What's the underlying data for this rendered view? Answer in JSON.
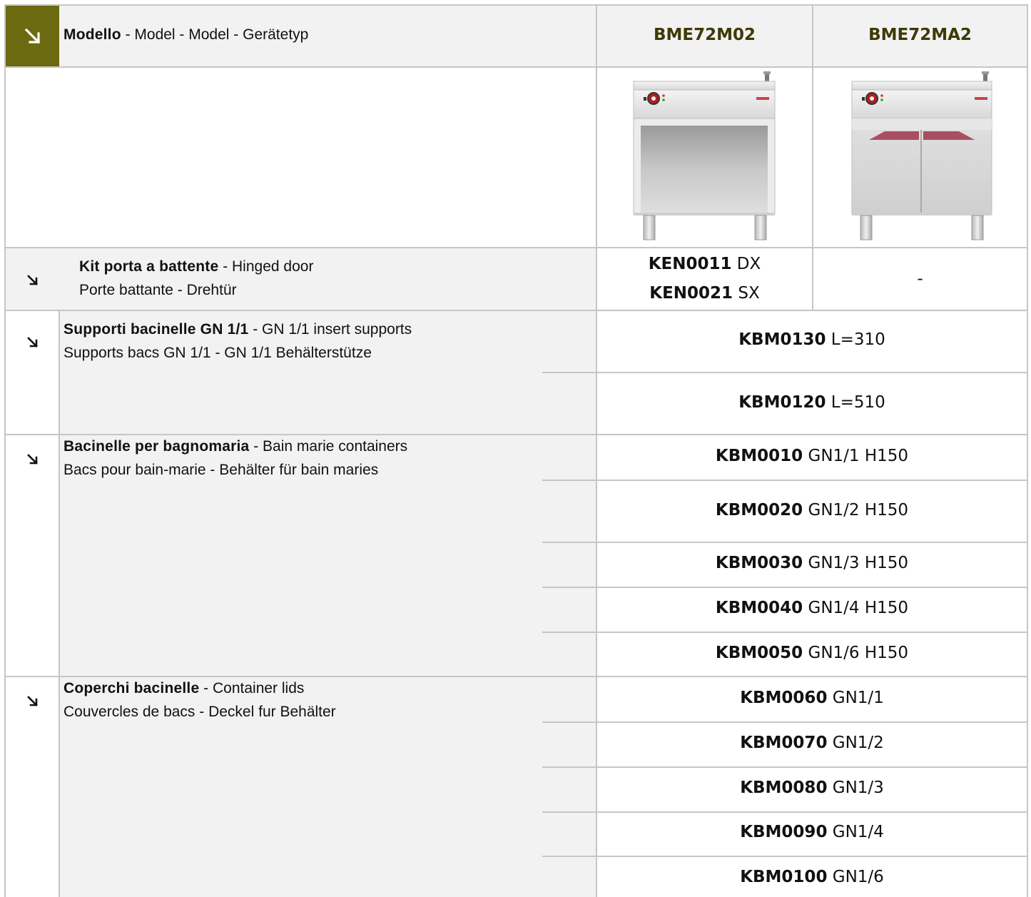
{
  "header": {
    "label_bold": "Modello",
    "label_rest": " - Model - Model - Gerätetyp",
    "models": [
      "BME72M02",
      "BME72MA2"
    ]
  },
  "icons": {
    "header_arrow": "arrow-down-right-icon",
    "row_arrow": "arrow-down-right-icon"
  },
  "colors": {
    "accent": "#6b6a10",
    "model_text": "#3d3a06",
    "grey_fill": "#f2f2f2",
    "grid": "#c6c6c6"
  },
  "accessories": [
    {
      "label_bold": "Kit porta a battente",
      "label_line1_rest": " - Hinged door",
      "label_line2": "Porte battante - Drehtür",
      "col1": [
        {
          "code": "KEN0011",
          "suffix": " DX"
        },
        {
          "code": "KEN0021",
          "suffix": " SX"
        }
      ],
      "col2": "-"
    },
    {
      "label_bold": "Supporti bacinelle GN 1/1",
      "label_line1_rest": " - GN 1/1 insert supports",
      "label_line2": "Supports bacs GN 1/1 - GN 1/1 Behälterstütze",
      "items": [
        {
          "code": "KBM0130",
          "suffix": " L=310"
        },
        {
          "code": "KBM0120",
          "suffix": " L=510"
        }
      ]
    },
    {
      "label_bold": "Bacinelle per bagnomaria",
      "label_line1_rest": " - Bain marie containers",
      "label_line2": "Bacs pour bain-marie - Behälter für bain maries",
      "items": [
        {
          "code": "KBM0010",
          "suffix": " GN1/1 H150"
        },
        {
          "code": "KBM0020",
          "suffix": " GN1/2 H150"
        },
        {
          "code": "KBM0030",
          "suffix": " GN1/3 H150"
        },
        {
          "code": "KBM0040",
          "suffix": " GN1/4 H150"
        },
        {
          "code": "KBM0050",
          "suffix": " GN1/6 H150"
        }
      ]
    },
    {
      "label_bold": "Coperchi bacinelle",
      "label_line1_rest": " - Container lids",
      "label_line2": "Couvercles de bacs - Deckel fur Behälter",
      "items": [
        {
          "code": "KBM0060",
          "suffix": " GN1/1"
        },
        {
          "code": "KBM0070",
          "suffix": " GN1/2"
        },
        {
          "code": "KBM0080",
          "suffix": " GN1/3"
        },
        {
          "code": "KBM0090",
          "suffix": " GN1/4"
        },
        {
          "code": "KBM0100",
          "suffix": " GN1/6"
        }
      ]
    }
  ]
}
